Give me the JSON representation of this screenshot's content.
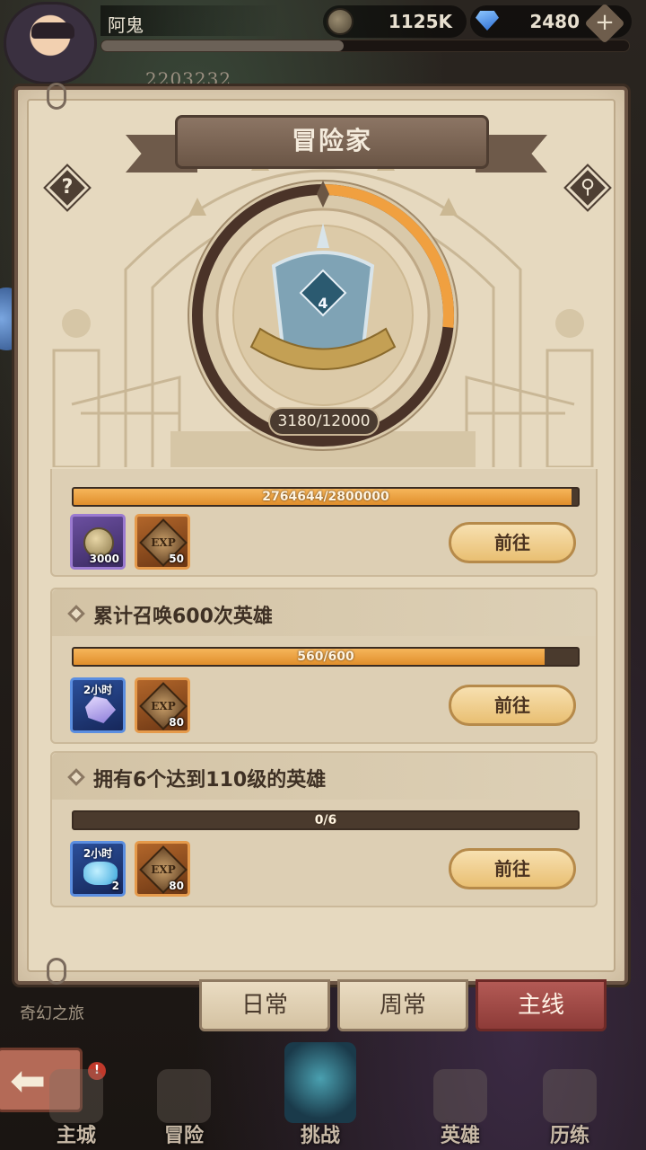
{
  "player": {
    "name": "阿鬼",
    "power": "2203232",
    "gold": "1125K",
    "diamonds": "2480",
    "add_symbol": "+",
    "xp_fill": 0.46
  },
  "panel": {
    "title": "冒险家",
    "help_symbol": "?",
    "search_symbol": "⚲",
    "rank_level": "4",
    "rank_progress_text": "3180/12000",
    "rank_progress": {
      "current": 3180,
      "max": 12000
    }
  },
  "quests": [
    {
      "label": "",
      "progress_text": "2764644/2800000",
      "progress": {
        "current": 2764644,
        "max": 2800000
      },
      "rewards": [
        {
          "kind": "gold-coin",
          "time": "",
          "count": "3000"
        },
        {
          "kind": "exp",
          "glyph_text": "EXP",
          "count": "50"
        }
      ],
      "button": "前往"
    },
    {
      "label": "累计召唤600次英雄",
      "progress_text": "560/600",
      "progress": {
        "current": 560,
        "max": 600
      },
      "rewards": [
        {
          "kind": "hero-crystal",
          "time": "2小时",
          "count": ""
        },
        {
          "kind": "exp",
          "glyph_text": "EXP",
          "count": "80"
        }
      ],
      "button": "前往"
    },
    {
      "label": "拥有6个达到110级的英雄",
      "progress_text": "0/6",
      "progress": {
        "current": 0,
        "max": 6
      },
      "rewards": [
        {
          "kind": "spirit-stone",
          "time": "2小时",
          "count": "2"
        },
        {
          "kind": "exp",
          "glyph_text": "EXP",
          "count": "80"
        }
      ],
      "button": "前往"
    }
  ],
  "tabs": {
    "daily": "日常",
    "weekly": "周常",
    "main": "主线"
  },
  "region": "奇幻之旅",
  "nav": {
    "back_symbol": "⬅",
    "home": "主城",
    "adventure": "冒险",
    "challenge": "挑战",
    "heroes": "英雄",
    "trials": "历练",
    "badge": "!"
  },
  "colors": {
    "accent_orange": "#f0a040",
    "active_tab": "#a54a46",
    "panel_paper": "#e2d3b8"
  }
}
